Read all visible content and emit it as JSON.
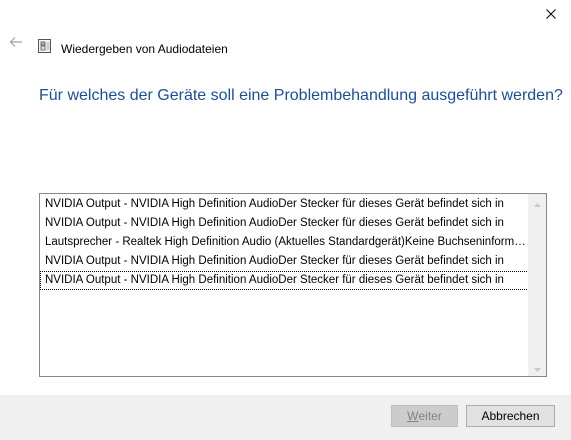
{
  "window": {
    "title": "Wiedergeben von Audiodateien",
    "icons": {
      "close": "close-icon",
      "back": "back-arrow-icon",
      "app": "audio-troubleshooter-icon"
    }
  },
  "main": {
    "heading": "Für welches der Geräte soll eine Problembehandlung ausgeführt werden?",
    "devices": [
      "NVIDIA Output - NVIDIA High Definition AudioDer Stecker für dieses Gerät befindet sich in",
      "NVIDIA Output - NVIDIA High Definition AudioDer Stecker für dieses Gerät befindet sich in",
      "Lautsprecher - Realtek High Definition Audio (Aktuelles Standardgerät)Keine Buchseninformationen",
      "NVIDIA Output - NVIDIA High Definition AudioDer Stecker für dieses Gerät befindet sich in",
      "NVIDIA Output - NVIDIA High Definition AudioDer Stecker für dieses Gerät befindet sich in"
    ],
    "selected_index": 4
  },
  "footer": {
    "next_label_accel": "W",
    "next_label_rest": "eiter",
    "cancel_label": "Abbrechen"
  },
  "colors": {
    "heading": "#1a4f9a",
    "footer_bg": "#f0f0f0",
    "disabled_button_bg": "#cccccc",
    "disabled_text": "#838383"
  }
}
